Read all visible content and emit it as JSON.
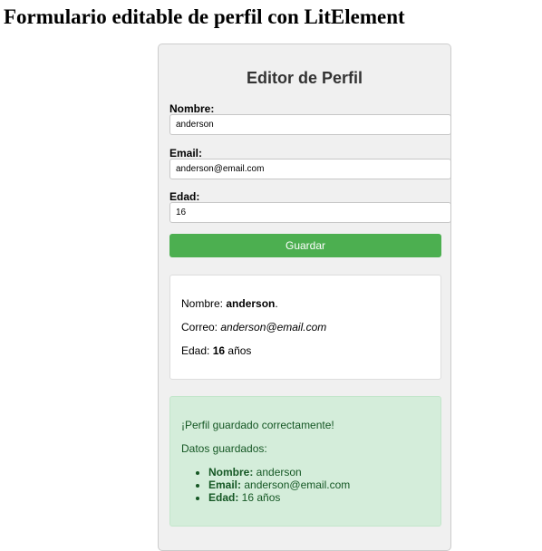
{
  "page": {
    "title": "Formulario editable de perfil con LitElement"
  },
  "form": {
    "title": "Editor de Perfil",
    "name_label": "Nombre:",
    "name_value": "anderson",
    "email_label": "Email:",
    "email_value": "anderson@email.com",
    "age_label": "Edad:",
    "age_value": "16",
    "save_label": "Guardar"
  },
  "summary": {
    "name_prefix": "Nombre: ",
    "name_value": "anderson",
    "name_suffix": ".",
    "email_prefix": "Correo: ",
    "email_value": "anderson@email.com",
    "age_prefix": "Edad: ",
    "age_value": "16",
    "age_suffix": " años"
  },
  "success": {
    "message": "¡Perfil guardado correctamente!",
    "subtitle": "Datos guardados:",
    "items": [
      {
        "label": "Nombre:",
        "value": " anderson"
      },
      {
        "label": "Email:",
        "value": " anderson@email.com"
      },
      {
        "label": "Edad:",
        "value": " 16 años"
      }
    ]
  },
  "colors": {
    "button": "#4caf50",
    "success_bg": "#d4edda",
    "success_text": "#155724"
  }
}
